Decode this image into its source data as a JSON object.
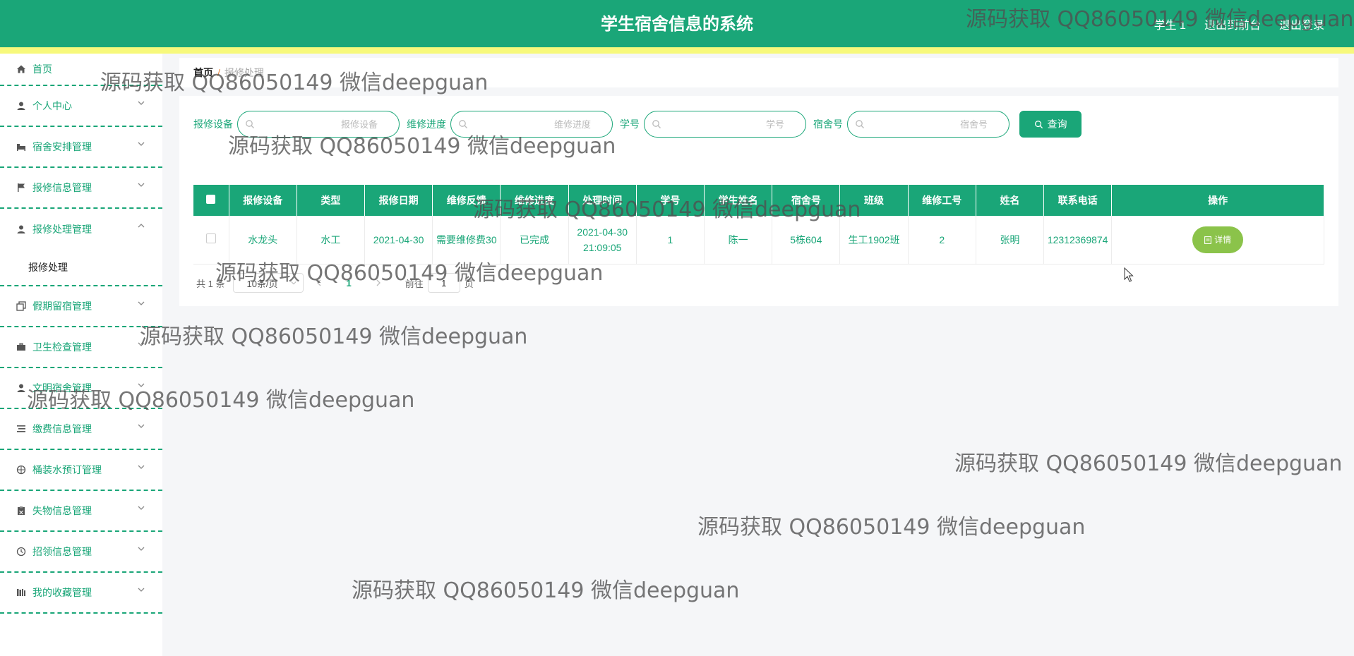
{
  "header": {
    "title": "学生宿舍信息的系统",
    "links": [
      "学生 1",
      "退出到前台",
      "退出登录"
    ]
  },
  "sidebar": {
    "items": [
      {
        "label": "首页",
        "icon": "home-icon"
      },
      {
        "label": "个人中心",
        "icon": "user-icon"
      },
      {
        "label": "宿舍安排管理",
        "icon": "bed-icon"
      },
      {
        "label": "报修信息管理",
        "icon": "flag-icon"
      },
      {
        "label": "报修处理管理",
        "icon": "user-icon"
      },
      {
        "label": "假期留宿管理",
        "icon": "copy-icon"
      },
      {
        "label": "卫生检查管理",
        "icon": "briefcase-icon"
      },
      {
        "label": "文明宿舍管理",
        "icon": "user-icon"
      },
      {
        "label": "缴费信息管理",
        "icon": "list-icon"
      },
      {
        "label": "桶装水预订管理",
        "icon": "target-icon"
      },
      {
        "label": "失物信息管理",
        "icon": "clipboard-icon"
      },
      {
        "label": "招领信息管理",
        "icon": "clock-icon"
      },
      {
        "label": "我的收藏管理",
        "icon": "bookshelf-icon"
      }
    ],
    "active_sub": "报修处理"
  },
  "breadcrumb": {
    "home": "首页",
    "separator": "/",
    "current": "报修处理"
  },
  "search": {
    "fields": [
      {
        "label": "报修设备",
        "placeholder": "报修设备"
      },
      {
        "label": "维修进度",
        "placeholder": "维修进度"
      },
      {
        "label": "学号",
        "placeholder": "学号"
      },
      {
        "label": "宿舍号",
        "placeholder": "宿舍号"
      }
    ],
    "button": "查询"
  },
  "table": {
    "columns": [
      "报修设备",
      "类型",
      "报修日期",
      "维修反馈",
      "维修进度",
      "处理时间",
      "学号",
      "学生姓名",
      "宿舍号",
      "班级",
      "维修工号",
      "姓名",
      "联系电话",
      "操作"
    ],
    "rows": [
      {
        "cells": [
          "水龙头",
          "水工",
          "2021-04-30",
          "需要维修费30",
          "已完成",
          "2021-04-30 21:09:05",
          "1",
          "陈一",
          "5栋604",
          "生工1902班",
          "2",
          "张明",
          "12312369874"
        ],
        "action": "详情"
      }
    ]
  },
  "pagination": {
    "total": "共 1 条",
    "page_size": "10条/页",
    "current_page": "1",
    "goto_prefix": "前往",
    "goto_value": "1",
    "goto_suffix": "页"
  },
  "watermark": "源码获取 QQ86050149 微信deepguan",
  "colors": {
    "primary": "#1aa678",
    "stripe": "#f7f97c",
    "detail_button": "#8bc34a"
  }
}
